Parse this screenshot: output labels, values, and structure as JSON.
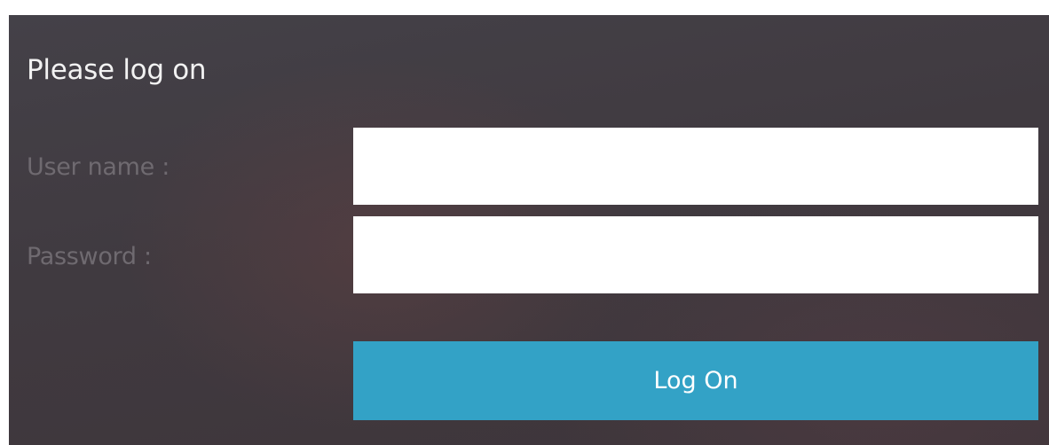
{
  "login": {
    "title": "Please log on",
    "username_label": "User name :",
    "username_value": "",
    "password_label": "Password :",
    "password_value": "",
    "logon_button_label": "Log On"
  },
  "colors": {
    "button_accent": "#33a2c6",
    "panel_background": "#423b41",
    "label_text": "#6f6a70",
    "title_text": "#f2f2f2"
  }
}
